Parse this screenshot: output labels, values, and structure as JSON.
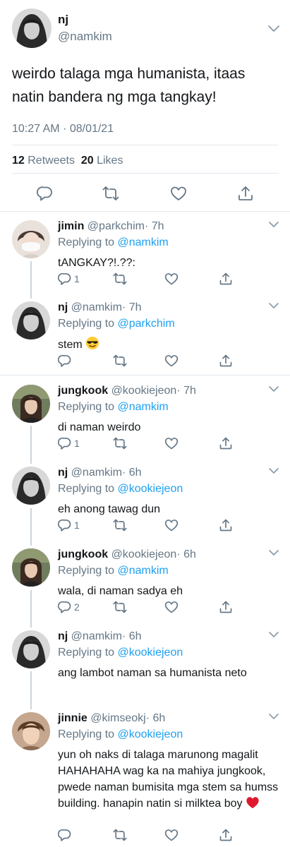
{
  "main_tweet": {
    "name": "nj",
    "handle": "@namkim",
    "text": "weirdo talaga mga humanista, itaas natin bandera ng mga tangkay!",
    "timestamp": "10:27 AM · 08/01/21",
    "retweets_count": "12",
    "retweets_label": "Retweets",
    "likes_count": "20",
    "likes_label": "Likes"
  },
  "replies": [
    {
      "name": "jimin",
      "handle": "@parkchim",
      "age": "· 7h",
      "replying_prefix": "Replying to",
      "replying_to": "@namkim",
      "text": "tANGKAY?!.??:",
      "reply_count": "1",
      "emoji": ""
    },
    {
      "name": "nj",
      "handle": "@namkim",
      "age": "· 7h",
      "replying_prefix": "Replying to",
      "replying_to": "@parkchim",
      "text": "stem",
      "reply_count": "",
      "emoji": "smiling-face-with-sunglasses"
    },
    {
      "name": "jungkook",
      "handle": "@kookiejeon",
      "age": "· 7h",
      "replying_prefix": "Replying to",
      "replying_to": "@namkim",
      "text": "di naman weirdo",
      "reply_count": "1",
      "emoji": ""
    },
    {
      "name": "nj",
      "handle": "@namkim",
      "age": "· 6h",
      "replying_prefix": "Replying to",
      "replying_to": "@kookiejeon",
      "text": "eh anong tawag dun",
      "reply_count": "1",
      "emoji": ""
    },
    {
      "name": "jungkook",
      "handle": "@kookiejeon",
      "age": "· 6h",
      "replying_prefix": "Replying to",
      "replying_to": "@namkim",
      "text": "wala, di naman sadya eh",
      "reply_count": "2",
      "emoji": ""
    },
    {
      "name": "nj",
      "handle": "@namkim",
      "age": "· 6h",
      "replying_prefix": "Replying to",
      "replying_to": "@kookiejeon",
      "text": "ang lambot naman sa humanista neto",
      "reply_count": "",
      "emoji": ""
    },
    {
      "name": "jinnie",
      "handle": "@kimseokj",
      "age": "· 6h",
      "replying_prefix": "Replying to",
      "replying_to": "@kookiejeon",
      "text": "yun oh naks di talaga marunong magalit HAHAHAHA wag ka na mahiya jungkook, pwede naman bumisita mga stem sa humss building. hanapin natin si milktea boy",
      "reply_count": "",
      "emoji": "red-heart"
    }
  ],
  "colors": {
    "text": "#14171a",
    "secondary": "#657786",
    "link": "#1da1f2",
    "divider": "#e1e8ed",
    "thread_line": "#ccd6dd"
  },
  "icons": [
    "reply-icon",
    "retweet-icon",
    "like-icon",
    "share-icon",
    "chevron-down-icon"
  ]
}
